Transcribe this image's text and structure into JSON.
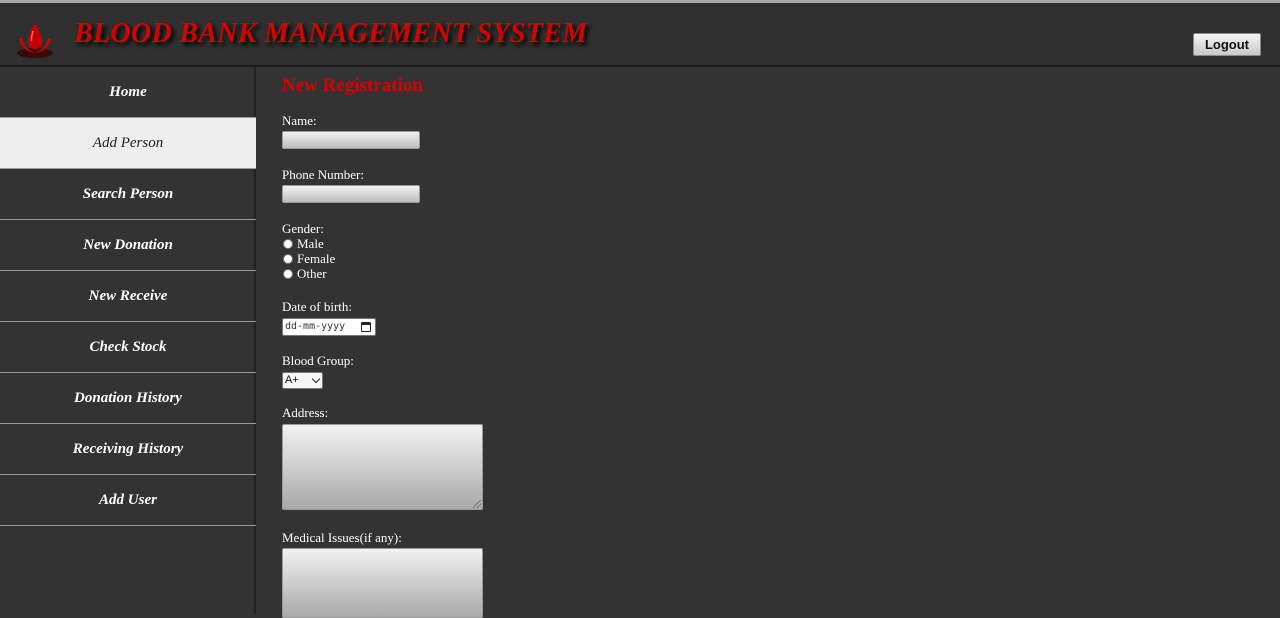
{
  "header": {
    "title": "BLOOD BANK MANAGEMENT SYSTEM",
    "logo_icon": "blood-drop-logo-icon",
    "logout_label": "Logout",
    "brand_color": "#d40000"
  },
  "sidebar": {
    "items": [
      {
        "label": "Home",
        "active": false
      },
      {
        "label": "Add Person",
        "active": true
      },
      {
        "label": "Search Person",
        "active": false
      },
      {
        "label": "New Donation",
        "active": false
      },
      {
        "label": "New Receive",
        "active": false
      },
      {
        "label": "Check Stock",
        "active": false
      },
      {
        "label": "Donation History",
        "active": false
      },
      {
        "label": "Receiving History",
        "active": false
      },
      {
        "label": "Add User",
        "active": false
      }
    ]
  },
  "form": {
    "title": "New Registration",
    "name_label": "Name:",
    "name_value": "",
    "phone_label": "Phone Number:",
    "phone_value": "",
    "gender_label": "Gender:",
    "gender_options": [
      "Male",
      "Female",
      "Other"
    ],
    "dob_label": "Date of birth:",
    "dob_placeholder": "dd-mm-yyyy",
    "blood_group_label": "Blood Group:",
    "blood_group_value": "A+",
    "address_label": "Address:",
    "address_value": "",
    "medical_label": "Medical Issues(if any):",
    "medical_value": ""
  }
}
